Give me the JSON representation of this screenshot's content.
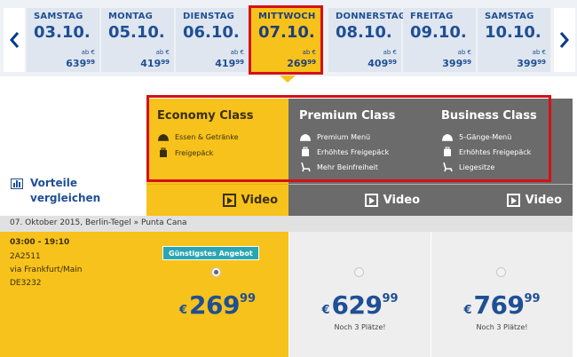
{
  "date_strip": {
    "days": [
      {
        "name": "SAMSTAG",
        "date": "03.10.",
        "from": "ab €",
        "price_main": "639",
        "price_cents": "99"
      },
      {
        "name": "MONTAG",
        "date": "05.10.",
        "from": "ab €",
        "price_main": "419",
        "price_cents": "99"
      },
      {
        "name": "DIENSTAG",
        "date": "06.10.",
        "from": "ab €",
        "price_main": "419",
        "price_cents": "99"
      },
      {
        "name": "MITTWOCH",
        "date": "07.10.",
        "from": "ab €",
        "price_main": "269",
        "price_cents": "99"
      },
      {
        "name": "DONNERSTAG",
        "date": "08.10.",
        "from": "ab €",
        "price_main": "409",
        "price_cents": "99"
      },
      {
        "name": "FREITAG",
        "date": "09.10.",
        "from": "ab €",
        "price_main": "399",
        "price_cents": "99"
      },
      {
        "name": "SAMSTAG",
        "date": "10.10.",
        "from": "ab €",
        "price_main": "399",
        "price_cents": "99"
      }
    ],
    "selected_day": "MITTWOCH",
    "prev_icon": "chevron-left-icon",
    "next_icon": "chevron-right-icon"
  },
  "classes": {
    "economy": {
      "name": "Economy Class",
      "features": [
        "Essen & Getränke",
        "Freigepäck"
      ],
      "video_label": "Video"
    },
    "premium": {
      "name": "Premium Class",
      "features": [
        "Premium Menü",
        "Erhöhtes Freigepäck",
        "Mehr Beinfreiheit"
      ],
      "video_label": "Video"
    },
    "business": {
      "name": "Business Class",
      "features": [
        "5-Gänge-Menü",
        "Erhöhtes Freigepäck",
        "Liegesitze"
      ],
      "video_label": "Video"
    }
  },
  "compare": {
    "line1": "Vorteile",
    "line2": "vergleichen"
  },
  "route": {
    "title": "07. Oktober 2015, Berlin-Tegel » Punta Cana"
  },
  "flight": {
    "time": "03:00 - 19:10",
    "lines": [
      "2A2511",
      "via Frankfurt/Main",
      "DE3232"
    ]
  },
  "fares": {
    "economy": {
      "badge": "Günstigstes Angebot",
      "currency": "€",
      "price_main": "269",
      "price_cents": "99",
      "selected": true
    },
    "premium": {
      "currency": "€",
      "price_main": "629",
      "price_cents": "99",
      "seats": "Noch 3 Plätze!",
      "selected": false
    },
    "business": {
      "currency": "€",
      "price_main": "769",
      "price_cents": "99",
      "seats": "Noch 3 Plätze!",
      "selected": false
    }
  },
  "colors": {
    "accent_yellow": "#f7c21b",
    "brand_blue": "#1f4f94",
    "highlight_red": "#d61018",
    "dark_gray": "#6b6b6b",
    "teal_badge": "#2aa6b3"
  }
}
